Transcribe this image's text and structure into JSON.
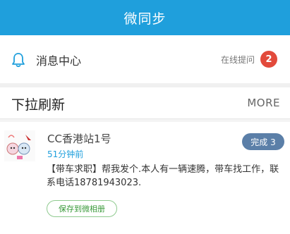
{
  "header": {
    "title": "微同步"
  },
  "notice": {
    "label": "消息中心",
    "online_label": "在线提问",
    "badge_count": "2",
    "icon": "bell-icon"
  },
  "refresh": {
    "label": "下拉刷新",
    "more_label": "MORE"
  },
  "post": {
    "username": "CC香港站1号",
    "time": "51分钟前",
    "status_label": "完成 3",
    "content": "【带车求职】帮我发个.本人有一辆速腾，带车找工作，联系电话18781943023.",
    "save_label": "保存到微相册"
  },
  "colors": {
    "header_bg": "#1f9fdc",
    "badge": "#e24a3b",
    "status_btn": "#5b7fa8",
    "save_btn": "#3a9a3a"
  }
}
